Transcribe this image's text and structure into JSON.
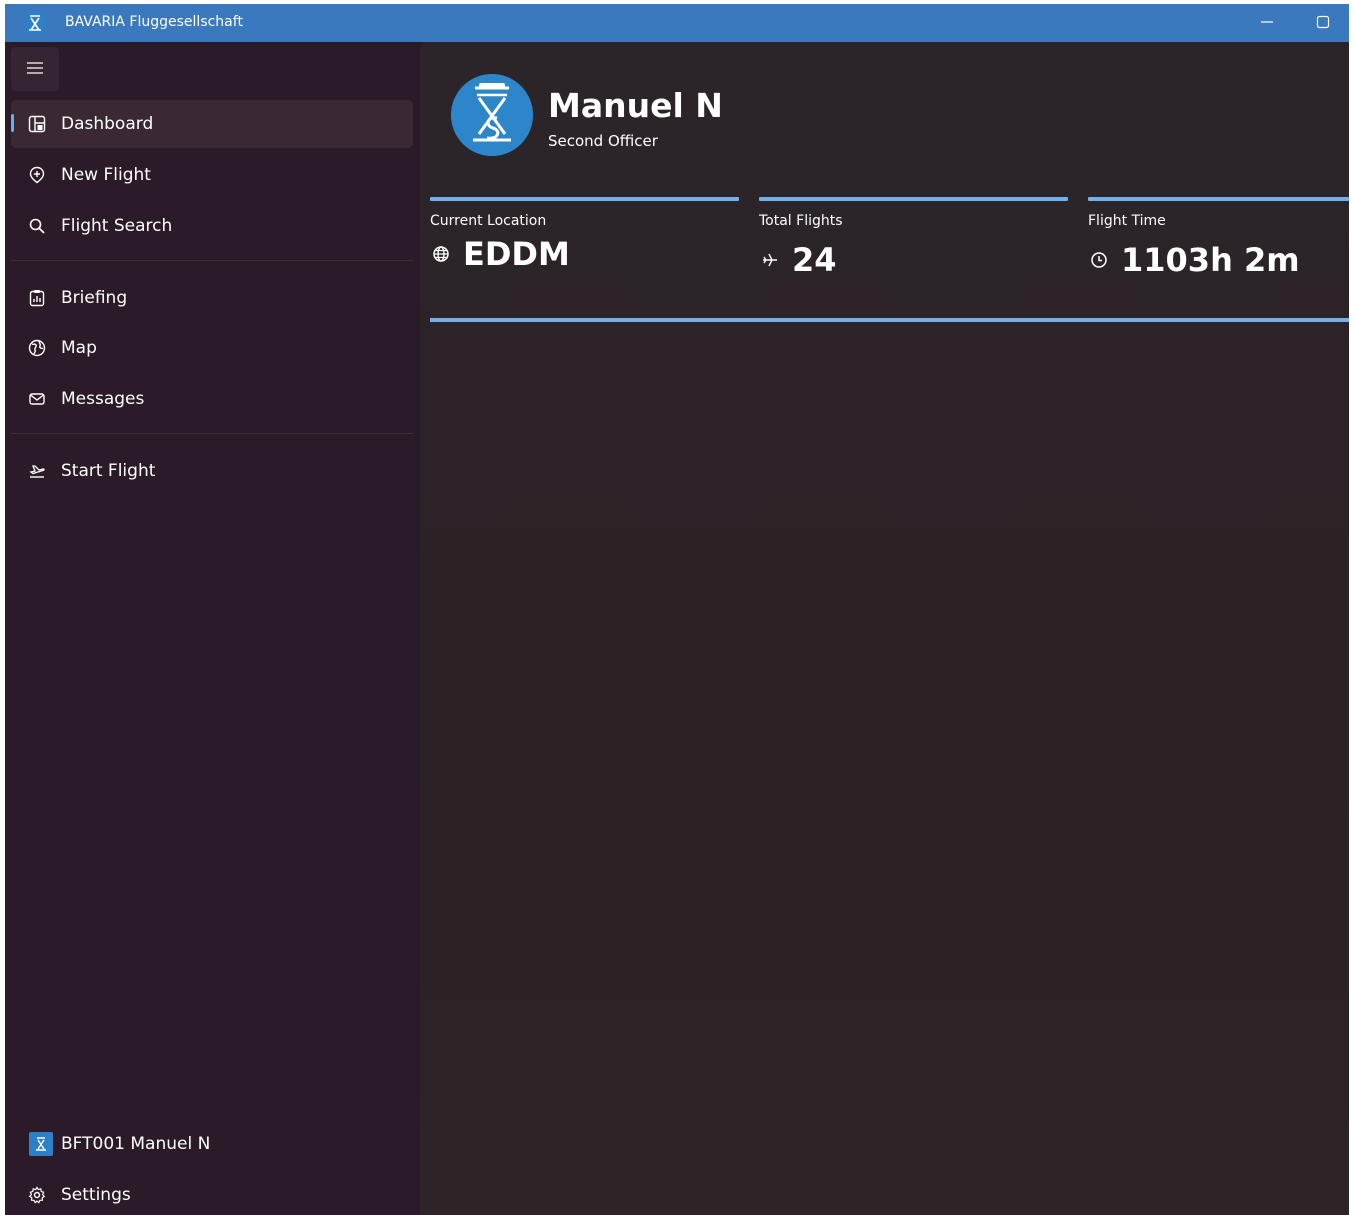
{
  "app": {
    "title": "BAVARIA Fluggesellschaft",
    "accent_color": "#3a79be",
    "highlight_color": "#74b0ea"
  },
  "window_controls": {
    "minimize_icon": "minimize-icon",
    "maximize_icon": "maximize-icon"
  },
  "sidebar": {
    "menu_icon": "hamburger-icon",
    "items": [
      {
        "label": "Dashboard",
        "icon": "dashboard-icon",
        "selected": true
      },
      {
        "label": "New Flight",
        "icon": "location-pin-icon"
      },
      {
        "label": "Flight Search",
        "icon": "search-icon"
      },
      {
        "label": "Briefing",
        "icon": "clipboard-chart-icon"
      },
      {
        "label": "Map",
        "icon": "globe-icon"
      },
      {
        "label": "Messages",
        "icon": "mail-icon"
      },
      {
        "label": "Start Flight",
        "icon": "airplane-takeoff-icon"
      }
    ],
    "footer": {
      "user_label": "BFT001 Manuel N",
      "user_icon": "user-avatar-icon",
      "settings_label": "Settings",
      "settings_icon": "gear-icon"
    }
  },
  "profile": {
    "name": "Manuel N",
    "role": "Second Officer",
    "avatar_icon": "bavaria-logo-icon"
  },
  "stats": [
    {
      "label": "Current Location",
      "value": "EDDM",
      "icon": "globe-icon"
    },
    {
      "label": "Total Flights",
      "value": "24",
      "icon": "airplane-icon"
    },
    {
      "label": "Flight Time",
      "value": "1103h 2m",
      "icon": "clock-icon"
    }
  ]
}
